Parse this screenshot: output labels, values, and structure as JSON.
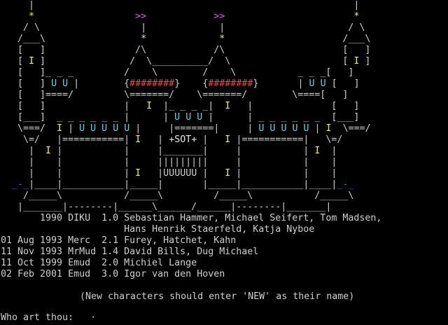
{
  "art_lines": [
    "     |                                                         |",
    "     *                  >>            >>                       *",
    "    / \\                  |             |                      / \\",
    "   /___\\                 *             *                     /___\\",
    "   [   ]                /\\            /\\                     [   ]",
    "   [ I ]               /  \\__________/  \\                    [ I ]",
    "   [   ]_ _ _         /    \\        /    \\           _ _ _[   ]",
    "   [   ] U U |        {########}    {########}       | U U [   ]",
    "   [   ]====/         \\=======/    \\=======/        \\====[   ]",
    "   [   ]              |   I  |_ _ _ _|  I   |              [   ]",
    "   [___]  _ _ _ _ _ _ |      | U U U |      | _ _ _ _ _ _  [___]",
    "   \\===/  I | U U U U U |     |=======|     | U U U U U | I  \\===/",
    "    \\=/   |===========| I   | +SOT+ |   I |===========|   \\=/",
    "     |  I |           |     |_______|     |           | I  |",
    "     |    |           |     |||||||||     |           |    |",
    "     |    |           | I   |UUUUUU |   I |           |    |",
    "  _-_|____|___________|_____|       |_____|___________|____|_-_",
    "    /_____\\           /_____\\         /_____\\           /_____\\",
    "   |_______|--------|______\\______/______|--------|_______|"
  ],
  "credits": [
    {
      "date": "",
      "mud": "1990 DIKU",
      "version": "1.0",
      "authors": "Sebastian Hammer, Michael Seifert, Tom Madsen,"
    },
    {
      "date": "",
      "mud": "",
      "version": "",
      "authors": "Hans Henrik Staerfeld, Katja Nyboe"
    },
    {
      "date": "01 Aug 1993",
      "mud": "Merc",
      "version": "2.1",
      "authors": "Furey, Hatchet, Kahn"
    },
    {
      "date": "11 Nov 1993",
      "mud": "MrMud",
      "version": "1.4",
      "authors": "David Bills, Dug Michael"
    },
    {
      "date": "11 Oct 1999",
      "mud": "Emud",
      "version": "2.0",
      "authors": "Michiel Lange"
    },
    {
      "date": "02 Feb 2001",
      "mud": "Emud",
      "version": "3.0",
      "authors": "Igor van den Hoven"
    }
  ],
  "notice": "(New characters should enter 'NEW' as their name)",
  "prompt": {
    "label": "Who art thou:",
    "input_value": "",
    "cursor": "·"
  },
  "colors": {
    "background": "#000000",
    "text": "#cfcfcf",
    "star": "#f2f24a",
    "pennant": "#e25ae2",
    "banner": "#e04a4a",
    "windows": "#5ad8e0",
    "moat": "#4a5ae8"
  }
}
